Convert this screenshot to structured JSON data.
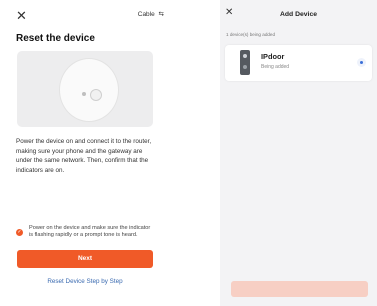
{
  "left": {
    "close_glyph": "✕",
    "cable_label": "Cable",
    "switch_icon": "⇆",
    "title": "Reset the device",
    "description": "Power the device on and connect it to the router, making sure your phone and the gateway are under the same network. Then, confirm that the indicators are on.",
    "confirm_text": "Power on the device and make sure the indicator is flashing rapidly or a prompt tone is heard.",
    "confirm_checked": true,
    "next_label": "Next",
    "step_link": "Reset Device Step by Step",
    "accent_color": "#f05a28"
  },
  "right": {
    "close_glyph": "✕",
    "title": "Add Device",
    "subtitle": "1 device(s) being added",
    "device": {
      "name": "IPdoor",
      "status": "Being added"
    },
    "done_button_color": "#f7cfc4"
  }
}
